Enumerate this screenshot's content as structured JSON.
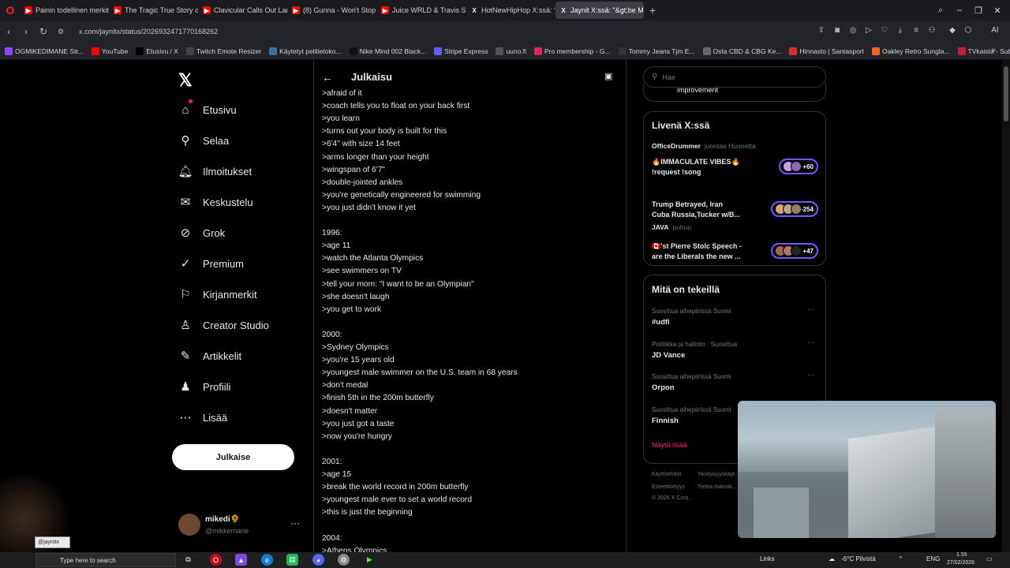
{
  "browser": {
    "tabs": [
      {
        "label": "Painin todellinen merkity...",
        "icon": "youtube-icon"
      },
      {
        "label": "The Tragic True Story of Ju...",
        "icon": "youtube-icon"
      },
      {
        "label": "Clavicular Calls Out Larry...",
        "icon": "youtube-icon"
      },
      {
        "label": "(8) Gunna - Won't Stop [O...",
        "icon": "youtube-icon"
      },
      {
        "label": "Juice WRLD & Travis Scott...",
        "icon": "youtube-icon"
      },
      {
        "label": "HotNewHipHop X:ssä: \"D...",
        "icon": "x-icon"
      },
      {
        "label": "Jaynit X:ssä: \"&gt;be Mich...",
        "icon": "x-icon",
        "active": true
      }
    ],
    "url": "x.com/jaynitx/status/2026932471770168262",
    "bookmarks": [
      {
        "label": "OGMIKEDIMANE Str...",
        "color": "#9146ff"
      },
      {
        "label": "YouTube",
        "color": "#ff0000"
      },
      {
        "label": "Etusivu / X",
        "color": "#000000"
      },
      {
        "label": "Twitch Emote Resizer",
        "color": "#444444"
      },
      {
        "label": "Käytetyt pelitietoko...",
        "color": "#3a6ea5"
      },
      {
        "label": "Nike Mind 002 Black...",
        "color": "#111111"
      },
      {
        "label": "Stripe Express",
        "color": "#635bff"
      },
      {
        "label": "uuno.fi",
        "color": "#555555"
      },
      {
        "label": "Pro membership - G...",
        "color": "#e0245e"
      },
      {
        "label": "Tommy Jeans Tjm E...",
        "color": "#333333"
      },
      {
        "label": "Osta CBD & CBG Ke...",
        "color": "#666666"
      },
      {
        "label": "Hinnasto | Santasport",
        "color": "#d62d2d"
      },
      {
        "label": "Oakley Retro Sungla...",
        "color": "#f26522"
      },
      {
        "label": "TVkaista - Sub Suora",
        "color": "#c41e3a"
      }
    ]
  },
  "sidebar": {
    "items": [
      {
        "label": "Etusivu",
        "icon": "home-icon"
      },
      {
        "label": "Selaa",
        "icon": "search-icon"
      },
      {
        "label": "Ilmoitukset",
        "icon": "bell-icon"
      },
      {
        "label": "Keskustelu",
        "icon": "mail-icon"
      },
      {
        "label": "Grok",
        "icon": "grok-icon"
      },
      {
        "label": "Premium",
        "icon": "verified-icon"
      },
      {
        "label": "Kirjanmerkit",
        "icon": "bookmark-icon"
      },
      {
        "label": "Creator Studio",
        "icon": "creator-icon"
      },
      {
        "label": "Artikkelit",
        "icon": "article-icon"
      },
      {
        "label": "Profiili",
        "icon": "profile-icon"
      },
      {
        "label": "Lisää",
        "icon": "more-icon"
      }
    ],
    "post_button": "Julkaise",
    "user": {
      "name": "mikedi🌻",
      "handle": "@mikkemane"
    }
  },
  "main": {
    "title": "Julkaisu",
    "lines": [
      ">afraid of it",
      ">coach tells you to float on your back first",
      ">you learn",
      ">turns out your body is built for this",
      ">6'4\" with size 14 feet",
      ">arms longer than your height",
      ">wingspan of 6'7\"",
      ">double-jointed ankles",
      ">you're genetically engineered for swimming",
      ">you just didn't know it yet",
      "",
      "1996:",
      ">age 11",
      ">watch the Atlanta Olympics",
      ">see swimmers on TV",
      ">tell your mom: \"I want to be an Olympian\"",
      ">she doesn't laugh",
      ">you get to work",
      "",
      "2000:",
      ">Sydney Olympics",
      ">you're 15 years old",
      ">youngest male swimmer on the U.S. team in 68 years",
      ">don't medal",
      ">finish 5th in the 200m butterfly",
      ">doesn't matter",
      ">you just got a taste",
      ">now you're hungry",
      "",
      "2001:",
      ">age 15",
      ">break the world record in 200m butterfly",
      ">youngest male ever to set a world record",
      ">this is just the beginning",
      "",
      "2004:",
      ">Athens Olympics"
    ]
  },
  "right": {
    "search_placeholder": "Hae",
    "prev_item_text": "improvement",
    "live": {
      "title": "Livenä X:ssä",
      "spaces": [
        {
          "host": "OfficeDrummer",
          "sub": "juontaa Huonetta",
          "title1": "🔥IMMACULATE VIBES🔥",
          "title2": "!request !song",
          "count": "+60"
        },
        {
          "host": "",
          "sub": "",
          "title1": "Trump Betrayed, Iran",
          "title2": "Cuba Russia,Tucker w/B...",
          "count": "+254"
        },
        {
          "host": "JAVA",
          "sub": "puhuu",
          "title1": "🇨🇦'st Pierre Stolc Speech -",
          "title2": "are the Liberals the new ...",
          "count": "+47"
        }
      ]
    },
    "trends": {
      "title": "Mitä on tekeillä",
      "items": [
        {
          "category": "Suosittua aihepiirissä Suomi",
          "topic": "#udfi"
        },
        {
          "category": "Politiikka ja hallinto · Suosittua",
          "topic": "JD Vance"
        },
        {
          "category": "Suosittua aihepiirissä Suomi",
          "topic": "Orpon"
        },
        {
          "category": "Suosittua aihepiirissä Suomi",
          "topic": "Finnish"
        }
      ],
      "show_more": "Näytä lisää"
    },
    "footer": {
      "line1a": "Käyttöehdot",
      "line1b": "Yksityisyyskäyt...",
      "line2a": "Esteettömyys",
      "line2b": "Tietoa mainok...",
      "line3": "© 2026 X Corp."
    }
  },
  "overlay": {
    "tooltip": "@jaynitx"
  },
  "taskbar": {
    "search_placeholder": "Type here to search",
    "links": "Links",
    "weather": "-6°C Pilvistä",
    "lang": "ENG",
    "time": "1.55",
    "date": "27/02/2026"
  },
  "colors": {
    "accent": "#1d9bf0",
    "space_border": "#7856ff",
    "pink": "#f91880"
  }
}
